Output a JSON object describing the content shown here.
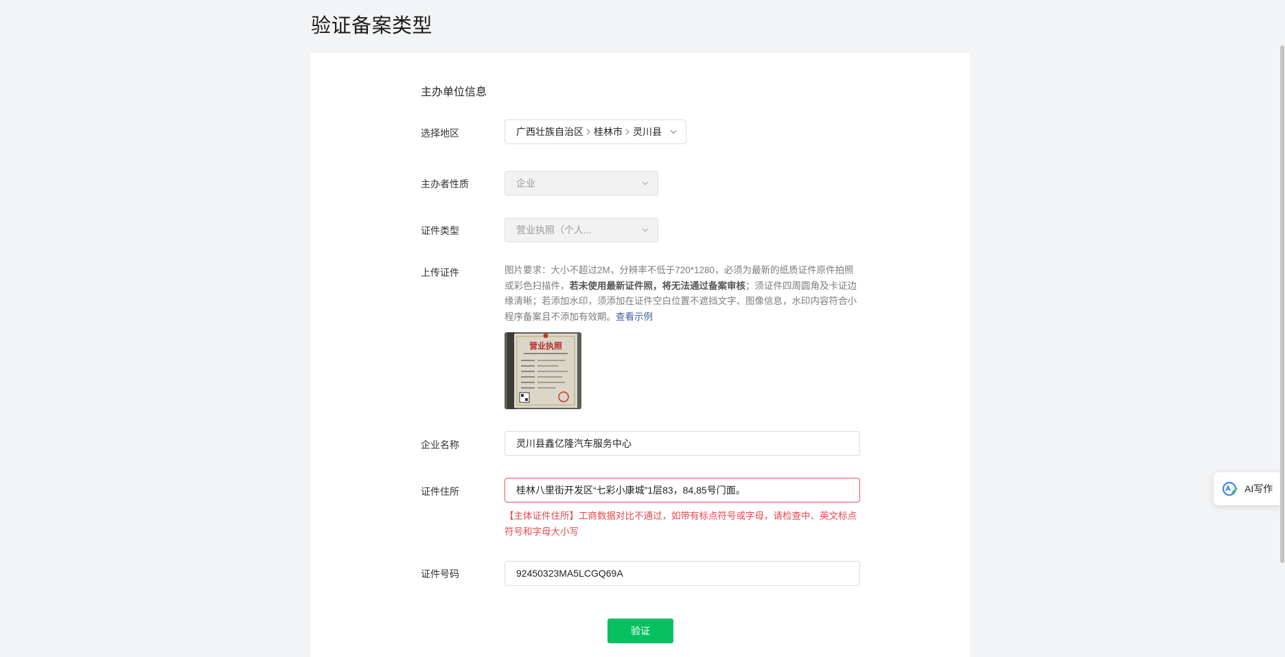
{
  "page": {
    "title": "验证备案类型"
  },
  "section": {
    "title": "主办单位信息"
  },
  "region": {
    "label": "选择地区",
    "province": "广西壮族自治区",
    "city": "桂林市",
    "county": "灵川县"
  },
  "organizer": {
    "label": "主办者性质",
    "value": "企业"
  },
  "cert_type": {
    "label": "证件类型",
    "value": "营业执照（个人..."
  },
  "upload": {
    "label": "上传证件",
    "hint_part1": "图片要求：大小不超过2M，分辨率不低于720*1280，必须为最新的纸质证件原件拍照或彩色扫描件，",
    "hint_bold": "若未使用最新证件照，将无法通过备案审核",
    "hint_part2": "；须证件四周圆角及卡证边缘清晰；若添加水印，须添加在证件空白位置不遮挡文字、图像信息，水印内容符合小程序备案且不添加有效期。",
    "example_link": "查看示例",
    "thumbnail_title": "营业执照"
  },
  "company_name": {
    "label": "企业名称",
    "value": "灵川县鑫亿隆汽车服务中心"
  },
  "address": {
    "label": "证件住所",
    "value": "桂林八里街开发区“七彩小康城”1层83，84,85号门面。",
    "error": "【主体证件住所】工商数据对比不通过，如带有标点符号或字母，请检查中、英文标点符号和字母大小写"
  },
  "cert_number": {
    "label": "证件号码",
    "value": "92450323MA5LCGQ69A"
  },
  "actions": {
    "verify_label": "验证"
  },
  "ai_widget": {
    "label": "AI写作",
    "icon": "ai-write-icon"
  },
  "colors": {
    "primary": "#07c160",
    "error": "#e5484d",
    "link": "#3f5e9e"
  }
}
